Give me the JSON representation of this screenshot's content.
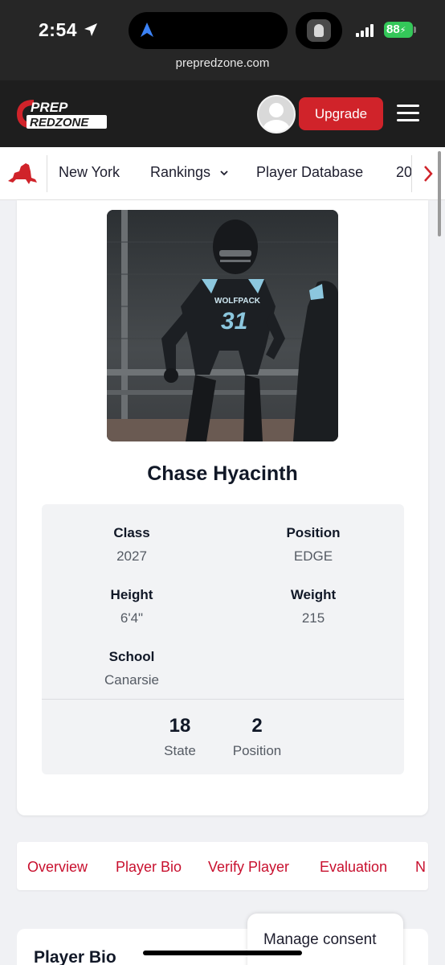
{
  "status_bar": {
    "time": "2:54",
    "battery": "88",
    "url": "prepredzone.com"
  },
  "header": {
    "logo_line1": "PREP",
    "logo_line2": "REDZONE",
    "upgrade_label": "Upgrade",
    "brand_color": "#d0232a"
  },
  "nav": {
    "items": [
      "New York",
      "Rankings",
      "Player Database",
      "20"
    ],
    "dropdown_icon": "chevron-down-icon"
  },
  "player": {
    "name": "Chase Hyacinth",
    "jersey_text": "WOLFPACK",
    "jersey_number": "31",
    "fields": [
      {
        "label": "Class",
        "value": "2027"
      },
      {
        "label": "Position",
        "value": "EDGE"
      },
      {
        "label": "Height",
        "value": "6'4\""
      },
      {
        "label": "Weight",
        "value": "215"
      },
      {
        "label": "School",
        "value": "Canarsie"
      }
    ],
    "rankings": [
      {
        "number": "18",
        "label": "State"
      },
      {
        "number": "2",
        "label": "Position"
      }
    ]
  },
  "tabs": [
    "Overview",
    "Player Bio",
    "Verify Player",
    "Evaluation",
    "N"
  ],
  "bio": {
    "title": "Player Bio"
  },
  "consent": {
    "label": "Manage consent"
  }
}
